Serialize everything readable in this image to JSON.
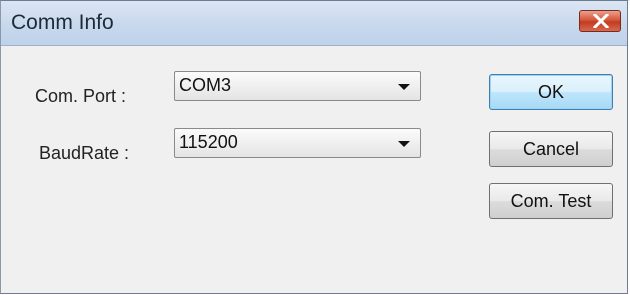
{
  "dialog": {
    "title": "Comm Info"
  },
  "fields": {
    "com_port": {
      "label": "Com. Port :",
      "value": "COM3"
    },
    "baud_rate": {
      "label": "BaudRate :",
      "value": "115200"
    }
  },
  "buttons": {
    "ok": "OK",
    "cancel": "Cancel",
    "com_test": "Com. Test"
  },
  "icons": {
    "close": "close-icon",
    "dropdown": "chevron-down-icon"
  },
  "colors": {
    "close_button": "#d04a2f",
    "default_button_border": "#3c7fb1",
    "dialog_background": "#f0f0f0"
  }
}
